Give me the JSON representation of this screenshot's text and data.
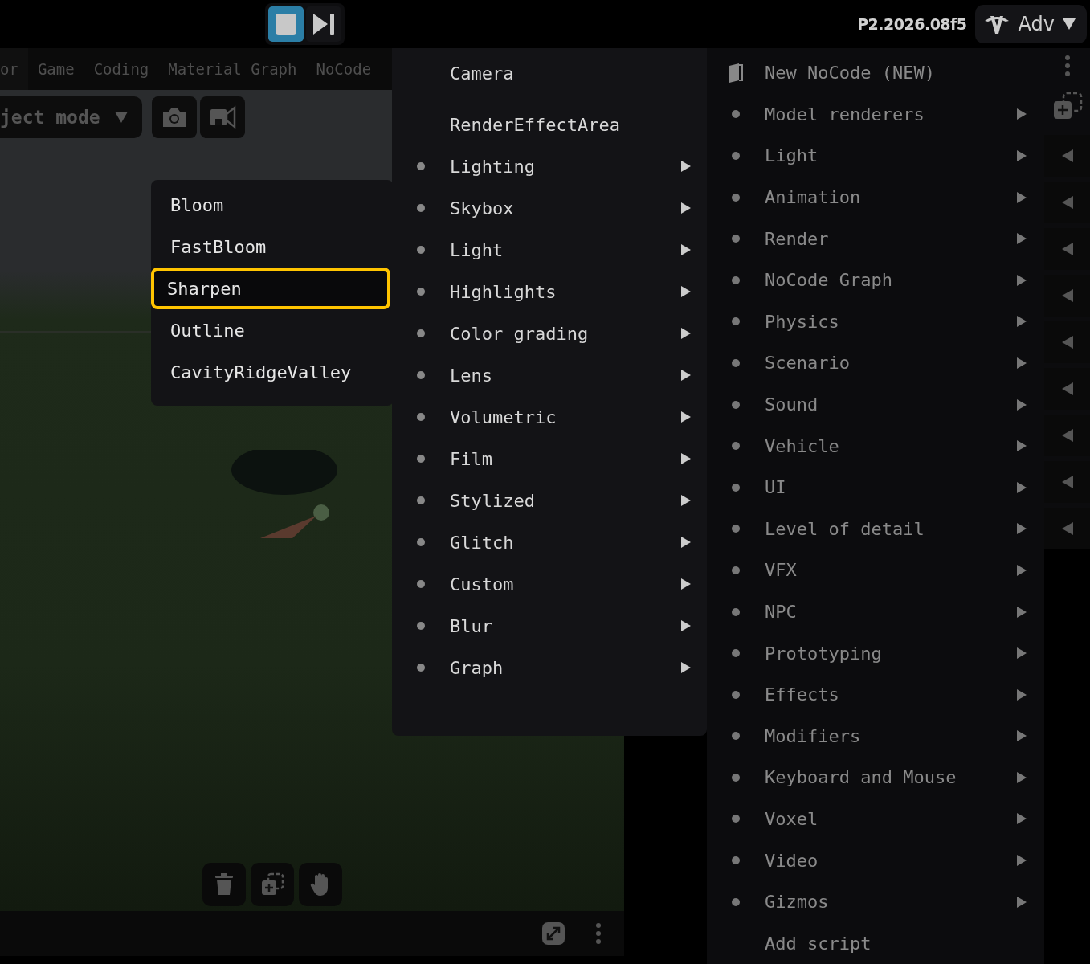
{
  "top_bar": {
    "version": "P2.2026.08f5",
    "profile": "Adv"
  },
  "tabs": [
    {
      "label": "or",
      "selected": true
    },
    {
      "label": "Game",
      "selected": false
    },
    {
      "label": "Coding",
      "selected": false
    },
    {
      "label": "Material Graph",
      "selected": false
    },
    {
      "label": "NoCode",
      "selected": false
    }
  ],
  "mode_dropdown": {
    "value": "ject mode"
  },
  "effect_submenu": [
    {
      "label": "Bloom",
      "selected": false
    },
    {
      "label": "FastBloom",
      "selected": false
    },
    {
      "label": "Sharpen",
      "selected": true
    },
    {
      "label": "Outline",
      "selected": false
    },
    {
      "label": "CavityRidgeValley",
      "selected": false
    }
  ],
  "effects_menu": [
    {
      "label": "Camera",
      "kind": "plain"
    },
    {
      "label": "RenderEffectArea",
      "kind": "plain"
    },
    {
      "label": "Lighting",
      "kind": "submenu"
    },
    {
      "label": "Skybox",
      "kind": "submenu"
    },
    {
      "label": "Light",
      "kind": "submenu"
    },
    {
      "label": "Highlights",
      "kind": "submenu"
    },
    {
      "label": "Color grading",
      "kind": "submenu"
    },
    {
      "label": "Lens",
      "kind": "submenu"
    },
    {
      "label": "Volumetric",
      "kind": "submenu"
    },
    {
      "label": "Film",
      "kind": "submenu"
    },
    {
      "label": "Stylized",
      "kind": "submenu"
    },
    {
      "label": "Glitch",
      "kind": "submenu"
    },
    {
      "label": "Custom",
      "kind": "submenu"
    },
    {
      "label": "Blur",
      "kind": "submenu"
    },
    {
      "label": "Graph",
      "kind": "submenu"
    }
  ],
  "components_menu": [
    {
      "label": "New NoCode (NEW)",
      "kind": "new"
    },
    {
      "label": "Model renderers",
      "kind": "submenu"
    },
    {
      "label": "Light",
      "kind": "submenu"
    },
    {
      "label": "Animation",
      "kind": "submenu"
    },
    {
      "label": "Render",
      "kind": "submenu"
    },
    {
      "label": "NoCode Graph",
      "kind": "submenu"
    },
    {
      "label": "Physics",
      "kind": "submenu"
    },
    {
      "label": "Scenario",
      "kind": "submenu"
    },
    {
      "label": "Sound",
      "kind": "submenu"
    },
    {
      "label": "Vehicle",
      "kind": "submenu"
    },
    {
      "label": "UI",
      "kind": "submenu"
    },
    {
      "label": "Level of detail",
      "kind": "submenu"
    },
    {
      "label": "VFX",
      "kind": "submenu"
    },
    {
      "label": "NPC",
      "kind": "submenu"
    },
    {
      "label": "Prototyping",
      "kind": "submenu"
    },
    {
      "label": "Effects",
      "kind": "submenu"
    },
    {
      "label": "Modifiers",
      "kind": "submenu"
    },
    {
      "label": "Keyboard and Mouse",
      "kind": "submenu"
    },
    {
      "label": "Voxel",
      "kind": "submenu"
    },
    {
      "label": "Video",
      "kind": "submenu"
    },
    {
      "label": "Gizmos",
      "kind": "submenu"
    },
    {
      "label": "Add script",
      "kind": "plain"
    }
  ]
}
